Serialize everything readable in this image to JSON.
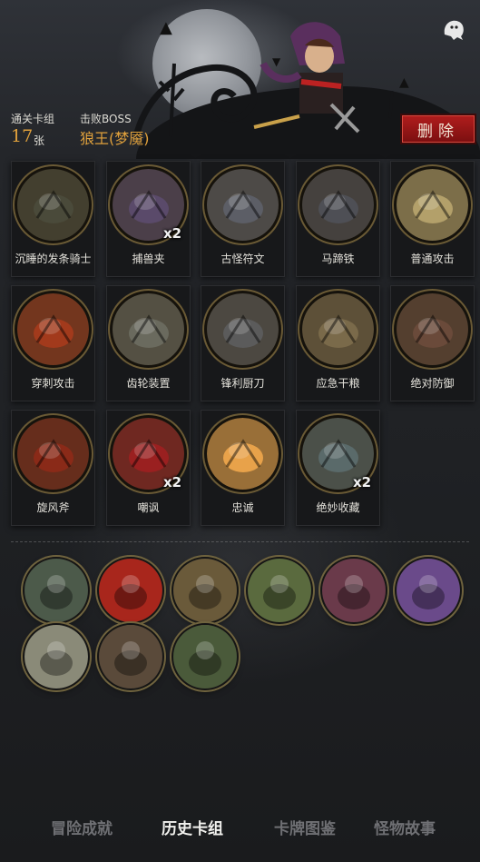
{
  "header": {
    "deck_label": "通关卡组",
    "deck_count": "17",
    "deck_unit": "张",
    "boss_label": "击败BOSS",
    "boss_name": "狼王(梦魇)",
    "delete_label": "删除"
  },
  "cards": [
    {
      "name": "沉睡的发条骑士",
      "multiplier": "",
      "icon": "clockwork-knight-icon",
      "color": "#4a4a3a"
    },
    {
      "name": "捕兽夹",
      "multiplier": "x2",
      "icon": "bear-trap-icon",
      "color": "#5a4a6a"
    },
    {
      "name": "古怪符文",
      "multiplier": "",
      "icon": "rune-stone-icon",
      "color": "#5c5e66"
    },
    {
      "name": "马蹄铁",
      "multiplier": "",
      "icon": "horseshoe-icon",
      "color": "#4e4f55"
    },
    {
      "name": "普通攻击",
      "multiplier": "",
      "icon": "sword-icon",
      "color": "#b3a06a"
    },
    {
      "name": "穿刺攻击",
      "multiplier": "",
      "icon": "spikes-icon",
      "color": "#a23a1c"
    },
    {
      "name": "齿轮装置",
      "multiplier": "",
      "icon": "gear-device-icon",
      "color": "#6a6a5e"
    },
    {
      "name": "锋利厨刀",
      "multiplier": "",
      "icon": "cleaver-icon",
      "color": "#5b5b5b"
    },
    {
      "name": "应急干粮",
      "multiplier": "",
      "icon": "rations-icon",
      "color": "#7a6a4a"
    },
    {
      "name": "绝对防御",
      "multiplier": "",
      "icon": "shield-dwarf-icon",
      "color": "#6a4a3a"
    },
    {
      "name": "旋风斧",
      "multiplier": "",
      "icon": "whirlwind-axe-icon",
      "color": "#8a2a18"
    },
    {
      "name": "嘲讽",
      "multiplier": "x2",
      "icon": "taunt-icon",
      "color": "#9a2020"
    },
    {
      "name": "忠诚",
      "multiplier": "",
      "icon": "loyalty-cross-icon",
      "color": "#e8a24a"
    },
    {
      "name": "绝妙收藏",
      "multiplier": "x2",
      "icon": "collection-box-icon",
      "color": "#5a6a6a"
    }
  ],
  "bosses": [
    {
      "icon": "goblin-bandit-icon",
      "color": "#4c5a4a"
    },
    {
      "icon": "fire-demon-icon",
      "color": "#a8261c"
    },
    {
      "icon": "treasure-chest-goblin-icon",
      "color": "#6a5a3a"
    },
    {
      "icon": "ghost-troll-icon",
      "color": "#5a6a3e"
    },
    {
      "icon": "vampire-icon",
      "color": "#6a3a4a"
    },
    {
      "icon": "witch-broom-icon",
      "color": "#6a4a8a"
    },
    {
      "icon": "boxing-ring-icon",
      "color": "#8a8a78"
    },
    {
      "icon": "barbarian-icon",
      "color": "#5a4a3a"
    },
    {
      "icon": "ghost-ogre-icon",
      "color": "#4a5a3a"
    }
  ],
  "tabs": [
    {
      "label": "冒险成就",
      "active": false
    },
    {
      "label": "历史卡组",
      "active": true
    },
    {
      "label": "卡牌图鉴",
      "active": false
    },
    {
      "label": "怪物故事",
      "active": false
    }
  ]
}
